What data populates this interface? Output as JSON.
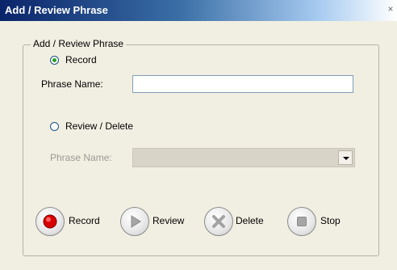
{
  "window": {
    "title": "Add / Review Phrase",
    "close_glyph": "×"
  },
  "group": {
    "legend": "Add / Review Phrase"
  },
  "record_option": {
    "label": "Record",
    "selected": true
  },
  "record_phrase": {
    "label": "Phrase Name:",
    "value": ""
  },
  "review_option": {
    "label": "Review / Delete",
    "selected": false
  },
  "review_phrase": {
    "label": "Phrase Name:",
    "selected_value": ""
  },
  "actions": {
    "record_label": "Record",
    "review_label": "Review",
    "delete_label": "Delete",
    "stop_label": "Stop"
  },
  "icons": {
    "record": "record-icon",
    "review": "play-icon",
    "delete": "delete-icon",
    "stop": "stop-icon"
  },
  "colors": {
    "title_start": "#0a246a",
    "title_end": "#a6caf0",
    "record_red": "#d90000",
    "radio_dot": "#21a121"
  }
}
